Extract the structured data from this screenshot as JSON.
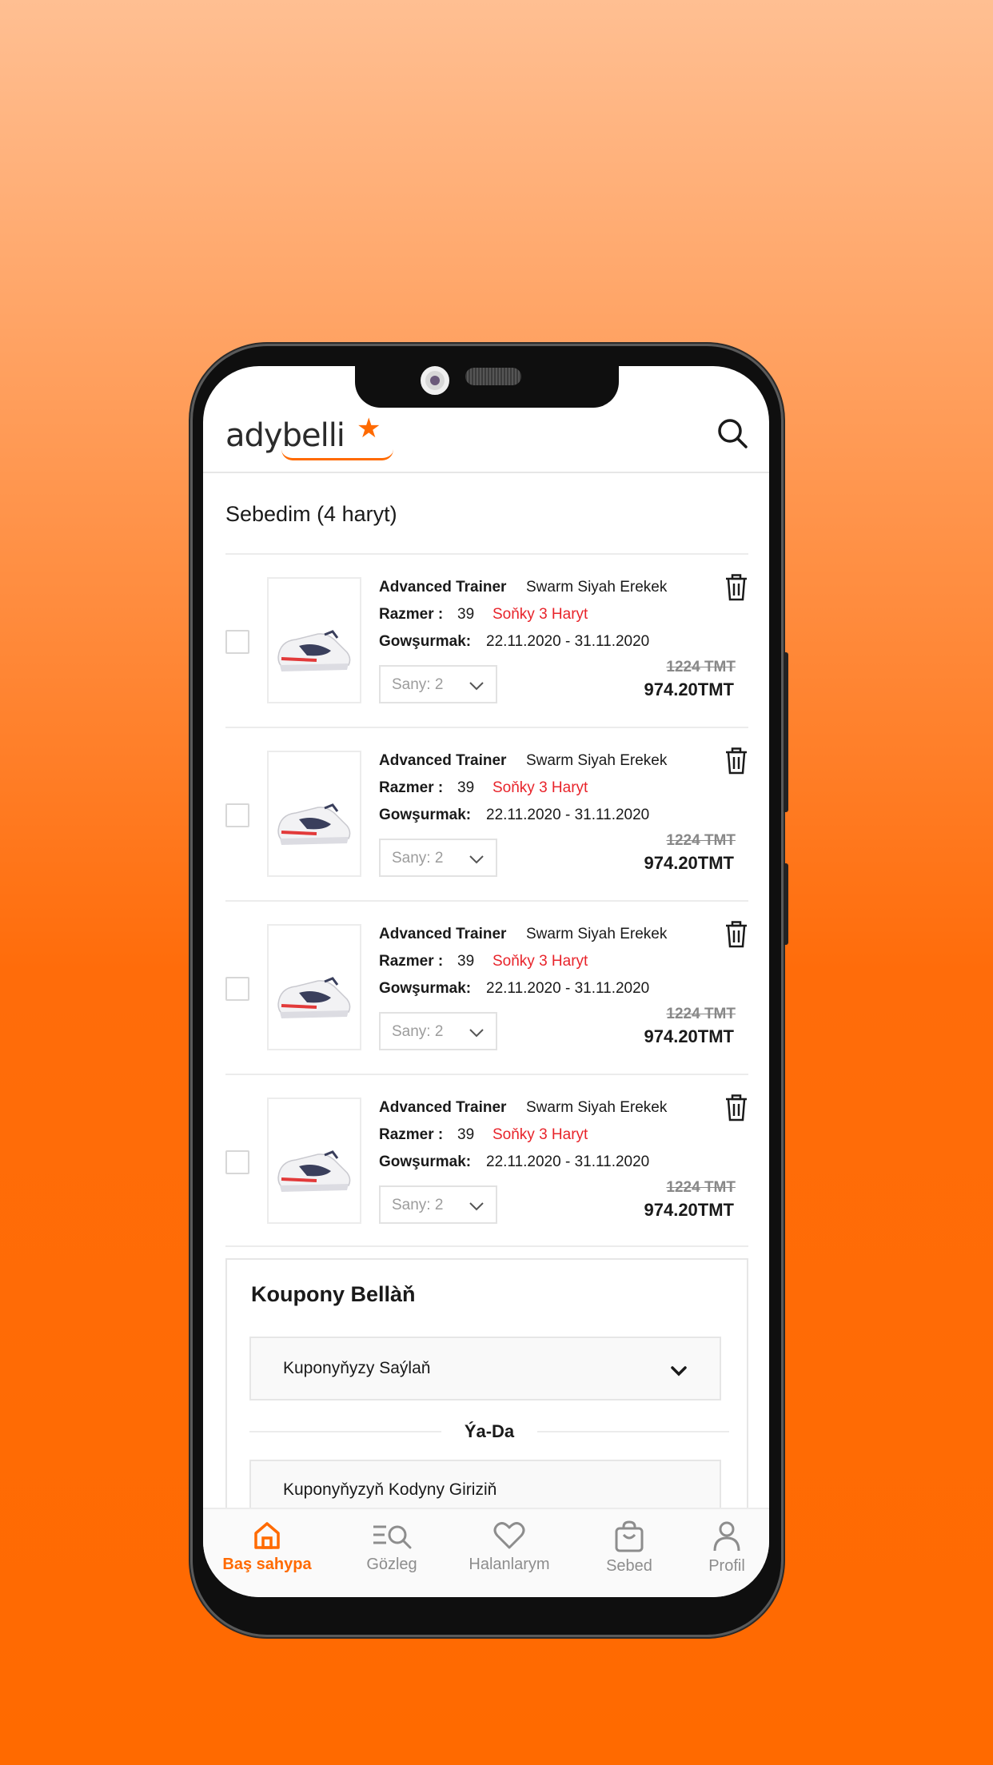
{
  "header": {
    "logo_text": "adybelli",
    "logo_star": "★"
  },
  "cart": {
    "title": "Sebedim (4 haryt)",
    "items": [
      {
        "name": "Advanced Trainer",
        "description": "Swarm Siyah Erekek",
        "size_label": "Razmer :",
        "size_value": "39",
        "stock_note": "Soňky 3 Haryt",
        "delivery_label": "Gowşurmak:",
        "delivery_value": "22.11.2020 - 31.11.2020",
        "qty_label": "Sany: 2",
        "old_price": "1224 TMT",
        "new_price": "974.20TMT"
      },
      {
        "name": "Advanced Trainer",
        "description": "Swarm Siyah Erekek",
        "size_label": "Razmer :",
        "size_value": "39",
        "stock_note": "Soňky 3 Haryt",
        "delivery_label": "Gowşurmak:",
        "delivery_value": "22.11.2020 - 31.11.2020",
        "qty_label": "Sany: 2",
        "old_price": "1224 TMT",
        "new_price": "974.20TMT"
      },
      {
        "name": "Advanced Trainer",
        "description": "Swarm Siyah Erekek",
        "size_label": "Razmer :",
        "size_value": "39",
        "stock_note": "Soňky 3 Haryt",
        "delivery_label": "Gowşurmak:",
        "delivery_value": "22.11.2020 - 31.11.2020",
        "qty_label": "Sany: 2",
        "old_price": "1224 TMT",
        "new_price": "974.20TMT"
      },
      {
        "name": "Advanced Trainer",
        "description": "Swarm Siyah Erekek",
        "size_label": "Razmer :",
        "size_value": "39",
        "stock_note": "Soňky 3 Haryt",
        "delivery_label": "Gowşurmak:",
        "delivery_value": "22.11.2020 - 31.11.2020",
        "qty_label": "Sany: 2",
        "old_price": "1224 TMT",
        "new_price": "974.20TMT"
      }
    ]
  },
  "coupon": {
    "title": "Koupony Bellàň",
    "select_label": "Kuponyňyzy Saýlaň",
    "or_text": "Ýa-Da",
    "code_label": "Kuponyňyzyň Kodyny Giriziň"
  },
  "nav": {
    "items": [
      {
        "label": "Baş sahypa",
        "icon": "home-icon",
        "active": true
      },
      {
        "label": "Gözleg",
        "icon": "search-list-icon",
        "active": false
      },
      {
        "label": "Halanlarym",
        "icon": "heart-icon",
        "active": false
      },
      {
        "label": "Sebed",
        "icon": "bag-icon",
        "active": false
      },
      {
        "label": "Profil",
        "icon": "user-icon",
        "active": false
      }
    ]
  },
  "colors": {
    "accent": "#ff6a00",
    "warning_red": "#e8242b",
    "background_top": "#ffbf92",
    "background_bottom": "#ff6a00"
  }
}
